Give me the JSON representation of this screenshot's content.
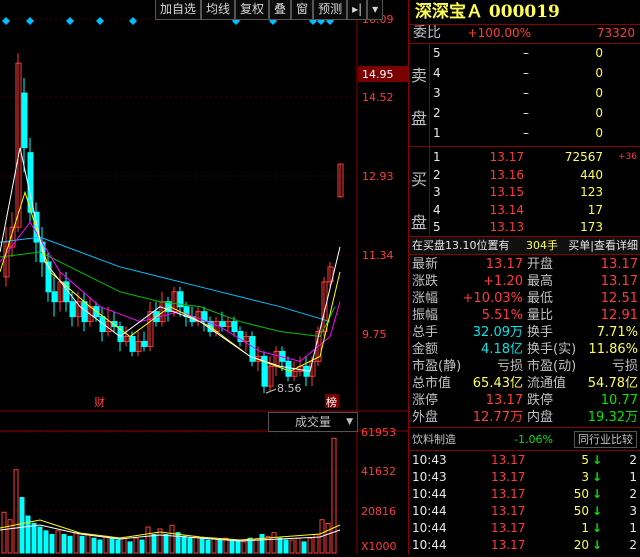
{
  "toolbar": {
    "buttons": [
      "加自选",
      "均线",
      "复权",
      "叠",
      "窗",
      "预测"
    ],
    "arrow_btn": "▸|",
    "dropdown": "▾"
  },
  "price_axis": {
    "ticks": [
      "16.09",
      "14.52",
      "12.93",
      "11.34",
      "9.75"
    ],
    "current": "14.95"
  },
  "price_chart": {
    "low_label": "8.56",
    "markers": [
      "财",
      "榜"
    ]
  },
  "volume": {
    "title": "成交量",
    "ticks": [
      "61953",
      "41632",
      "20816",
      "X1000"
    ]
  },
  "colors": {
    "up": "#ff3b3b",
    "down": "#00ffff",
    "ma_white": "#ffffff",
    "ma_yellow": "#ffff00",
    "ma_magenta": "#ff00ff",
    "ma_green": "#00c000",
    "ma_cyan": "#00bfff",
    "grid_red": "#8b0000"
  },
  "quote": {
    "title": "深深宝Ａ  000019",
    "weibi_label": "委比",
    "weibi_pct": "+100.00%",
    "weibi_val": "73320",
    "sell_label": "卖盘",
    "buy_label": "买盘",
    "asks": [
      {
        "n": "5",
        "price": "–",
        "vol": "0"
      },
      {
        "n": "4",
        "price": "–",
        "vol": "0"
      },
      {
        "n": "3",
        "price": "–",
        "vol": "0"
      },
      {
        "n": "2",
        "price": "–",
        "vol": "0"
      },
      {
        "n": "1",
        "price": "–",
        "vol": "0"
      }
    ],
    "bids": [
      {
        "n": "1",
        "price": "13.17",
        "vol": "72567",
        "chg": "+36"
      },
      {
        "n": "2",
        "price": "13.16",
        "vol": "440",
        "chg": ""
      },
      {
        "n": "3",
        "price": "13.15",
        "vol": "123",
        "chg": ""
      },
      {
        "n": "4",
        "price": "13.14",
        "vol": "17",
        "chg": ""
      },
      {
        "n": "5",
        "price": "13.13",
        "vol": "173",
        "chg": ""
      }
    ],
    "info_bar": {
      "left": "在买盘13.10位置有",
      "mid": "304手",
      "right": "买单|查看详细"
    },
    "stats": [
      {
        "l1": "最新",
        "v1": "13.17",
        "c1": "red",
        "l2": "开盘",
        "v2": "13.17",
        "c2": "red"
      },
      {
        "l1": "涨跌",
        "v1": "+1.20",
        "c1": "red",
        "l2": "最高",
        "v2": "13.17",
        "c2": "red"
      },
      {
        "l1": "涨幅",
        "v1": "+10.03%",
        "c1": "red",
        "l2": "最低",
        "v2": "12.51",
        "c2": "red"
      },
      {
        "l1": "振幅",
        "v1": "5.51%",
        "c1": "red",
        "l2": "量比",
        "v2": "12.91",
        "c2": "red"
      },
      {
        "l1": "总手",
        "v1": "32.09万",
        "c1": "cyan",
        "l2": "换手",
        "v2": "7.71%",
        "c2": "yel"
      },
      {
        "l1": "金额",
        "v1": "4.18亿",
        "c1": "cyan",
        "l2": "换手(实)",
        "v2": "11.86%",
        "c2": "yel"
      },
      {
        "l1": "市盈(静)",
        "v1": "亏损",
        "c1": "lbl",
        "l2": "市盈(动)",
        "v2": "亏损",
        "c2": "lbl"
      },
      {
        "l1": "总市值",
        "v1": "65.43亿",
        "c1": "yel",
        "l2": "流通值",
        "v2": "54.78亿",
        "c2": "yel"
      },
      {
        "l1": "涨停",
        "v1": "13.17",
        "c1": "red",
        "l2": "跌停",
        "v2": "10.77",
        "c2": "grn"
      },
      {
        "l1": "外盘",
        "v1": "12.77万",
        "c1": "red",
        "l2": "内盘",
        "v2": "19.32万",
        "c2": "grn"
      }
    ],
    "industry": {
      "name": "饮料制造",
      "chg": "-1.06%",
      "btn": "同行业比较"
    },
    "ticks": [
      {
        "time": "10:43",
        "price": "13.17",
        "vol": "5",
        "dir": "↓",
        "n": "2"
      },
      {
        "time": "10:43",
        "price": "13.17",
        "vol": "3",
        "dir": "↓",
        "n": "1"
      },
      {
        "time": "10:44",
        "price": "13.17",
        "vol": "50",
        "dir": "↓",
        "n": "2"
      },
      {
        "time": "10:44",
        "price": "13.17",
        "vol": "50",
        "dir": "↓",
        "n": "3"
      },
      {
        "time": "10:44",
        "price": "13.17",
        "vol": "1",
        "dir": "↓",
        "n": "1"
      },
      {
        "time": "10:44",
        "price": "13.17",
        "vol": "20",
        "dir": "↓",
        "n": "2"
      }
    ]
  }
}
